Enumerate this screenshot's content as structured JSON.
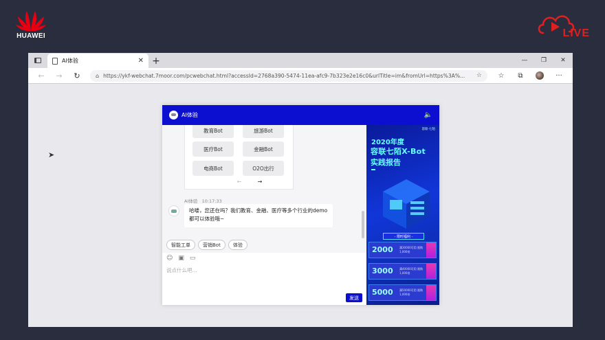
{
  "brand": {
    "left_logo_text": "HUAWEI",
    "right_logo_text": "LIVE"
  },
  "browser": {
    "tab": {
      "title": "AI体验",
      "close": "✕"
    },
    "new_tab": "+",
    "window_controls": {
      "minimize": "—",
      "restore": "❐",
      "close": "✕"
    },
    "nav": {
      "back": "←",
      "forward": "→",
      "refresh": "↻"
    },
    "url": "https://ykf-webchat.7moor.com/pcwebchat.html?accessId=2768a390-5474-11ea-afc9-7b323e2e16c0&urlTitle=im&fromUrl=https%3A%...",
    "lock_icon": "⌂",
    "favorite_icon": "☆",
    "toolbar_icons": {
      "favorites": "☆",
      "collections": "⧉",
      "menu": "···"
    }
  },
  "chat": {
    "header_title": "AI体验",
    "speaker_icon": "🔈",
    "bot_buttons": [
      "教育Bot",
      "旅游Bot",
      "医疗Bot",
      "金融Bot",
      "电商Bot",
      "O2O出行"
    ],
    "pager": {
      "prev": "←",
      "next": "→"
    },
    "message": {
      "sender": "AI体验",
      "time": "10:17:33",
      "text": "哈喽，您还在吗？我们教育、金融、医疗等多个行业的demo都可以体验哦~"
    },
    "quick_replies": [
      "智能工单",
      "营销Bot",
      "体验"
    ],
    "input_icons": {
      "emoji": "☺",
      "image": "▣",
      "folder": "▭"
    },
    "input_placeholder": "说点什么吧...",
    "send_label": "发送"
  },
  "ad": {
    "top_mini": "容联·七陌",
    "title_line1": "2020年度",
    "title_line2": "容联七陌X-Bot",
    "title_line3": "实践报告",
    "offer_title": "- 限时福利 -",
    "coupons": [
      {
        "amount": "2000",
        "desc": "满30000可用 限购1,000份"
      },
      {
        "amount": "3000",
        "desc": "满40000可用 限购1,000份"
      },
      {
        "amount": "5000",
        "desc": "满50000可用 限购1,000份"
      }
    ]
  }
}
